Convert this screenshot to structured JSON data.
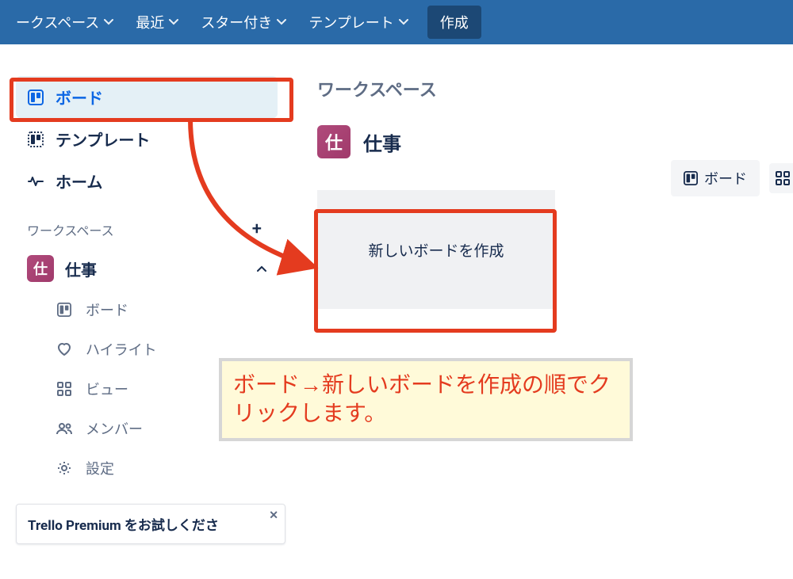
{
  "topnav": {
    "workspaces": "ークスペース",
    "recent": "最近",
    "starred": "スター付き",
    "templates": "テンプレート",
    "create": "作成"
  },
  "sidebar": {
    "boards": "ボード",
    "templates": "テンプレート",
    "home": "ホーム",
    "workspaces_label": "ワークスペース",
    "workspace": {
      "badge": "仕",
      "name": "仕事"
    },
    "sub": {
      "boards": "ボード",
      "highlights": "ハイライト",
      "views": "ビュー",
      "members": "メンバー",
      "settings": "設定"
    },
    "premium": "Trello Premium をお試しくださ"
  },
  "main": {
    "title": "ワークスペース",
    "workspace": {
      "badge": "仕",
      "name": "仕事"
    },
    "tabs": {
      "board": "ボード"
    },
    "new_board_tile": "新しいボードを作成"
  },
  "annotation": {
    "callout": "ボード→新しいボードを作成の順でクリックします。"
  }
}
